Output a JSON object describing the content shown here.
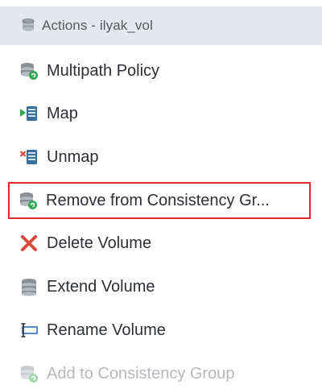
{
  "menu": {
    "header": {
      "title": "Actions - ilyak_vol",
      "icon": "volume-stack-icon"
    },
    "items": [
      {
        "label": "Multipath Policy",
        "icon": "multipath-policy-icon",
        "enabled": true,
        "highlighted": false
      },
      {
        "label": "Map",
        "icon": "map-icon",
        "enabled": true,
        "highlighted": false
      },
      {
        "label": "Unmap",
        "icon": "unmap-icon",
        "enabled": true,
        "highlighted": false
      },
      {
        "label": "Remove from Consistency Gr...",
        "icon": "consistency-group-icon",
        "enabled": true,
        "highlighted": true
      },
      {
        "label": "Delete Volume",
        "icon": "delete-x-icon",
        "enabled": true,
        "highlighted": false
      },
      {
        "label": "Extend Volume",
        "icon": "extend-volume-icon",
        "enabled": true,
        "highlighted": false
      },
      {
        "label": "Rename Volume",
        "icon": "rename-icon",
        "enabled": true,
        "highlighted": false
      },
      {
        "label": "Add to Consistency Group",
        "icon": "consistency-group-icon",
        "enabled": false,
        "highlighted": false
      }
    ]
  },
  "colors": {
    "header_bg": "#e4e8ee",
    "highlight_border": "#e02b2b",
    "disabled_text": "#b5b9bd",
    "icon_green": "#2fa84f",
    "icon_gray": "#8a9096",
    "icon_red": "#d94a3a",
    "icon_blue": "#2f6fb3"
  }
}
